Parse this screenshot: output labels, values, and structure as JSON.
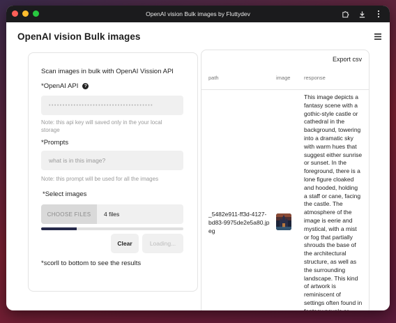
{
  "window": {
    "title": "OpenAI vision Bulk images by Fluttydev",
    "titlebar_icons": [
      "extension-icon",
      "download-icon",
      "more-vert-icon"
    ]
  },
  "app": {
    "title": "OpenAI vision Bulk images",
    "menu_icon": "hamburger-menu-icon"
  },
  "form": {
    "heading": "Scan images in bulk with OpenAI Vission API",
    "api_label": "*OpenAI API",
    "api_value": "••••••••••••••••••••••••••••••••••••••",
    "api_note": "Note: this api key will saved only in the your local storage",
    "prompts_label": "*Prompts",
    "prompts_placeholder": "what is in this image?",
    "prompts_note": "Note: this prompt will be used for all the images",
    "select_label": "*Select images",
    "choose_files_label": "CHOOSE FILES",
    "files_selected": "4 files",
    "progress_fraction": 0.25,
    "clear_label": "Clear",
    "loading_label": "Loading...",
    "scroll_note": "*scorll to bottom to see the results"
  },
  "results": {
    "export_label": "Export csv",
    "columns": [
      "path",
      "image",
      "response"
    ],
    "rows": [
      {
        "path": "_5482e911-ff3d-4127-bd83-9975de2e5a80.jpeg",
        "response": "This image depicts a fantasy scene with a gothic-style castle or cathedral in the background, towering into a dramatic sky with warm hues that suggest either sunrise or sunset. In the foreground, there is a lone figure cloaked and hooded, holding a staff or cane, facing the castle. The atmosphere of the image is eerie and mystical, with a mist or fog that partially shrouds the base of the architectural structure, as well as the surrounding landscape. This kind of artwork is reminiscent of settings often found in fantasy novels or"
      }
    ]
  },
  "colors": {
    "progress_fill": "#26294a",
    "titlebar_bg": "#1b1b1d"
  }
}
